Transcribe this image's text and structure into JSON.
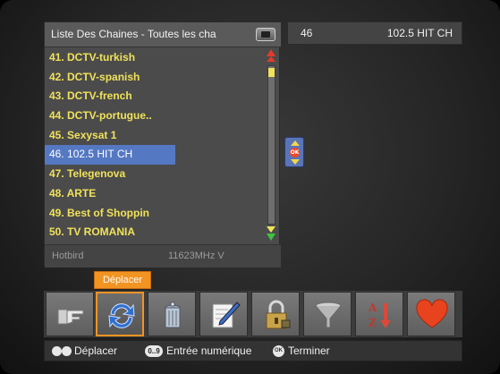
{
  "channel_list": {
    "title": "Liste Des Chaines - Toutes les cha",
    "rows": [
      "41. DCTV-turkish",
      "42. DCTV-spanish",
      "43. DCTV-french",
      "44. DCTV-portugue..",
      "45. Sexysat 1",
      "46. 102.5 HIT CH",
      "47. Telegenova",
      "48. ARTE",
      "49. Best of Shoppin",
      "50. TV ROMANIA"
    ],
    "selected_index": 5,
    "footer": {
      "satellite": "Hotbird",
      "frequency": "11623MHz V"
    }
  },
  "info": {
    "number": "46",
    "name": "102.5 HIT CH"
  },
  "ok_pad": {
    "label": "OK"
  },
  "tooltip": {
    "label": "Déplacer"
  },
  "toolbar": {
    "items": [
      {
        "icon": "hand-pointer-icon"
      },
      {
        "icon": "move-arrows-icon",
        "active": true
      },
      {
        "icon": "trash-icon"
      },
      {
        "icon": "edit-pen-icon"
      },
      {
        "icon": "lock-icon"
      },
      {
        "icon": "filter-funnel-icon"
      },
      {
        "icon": "sort-az-icon"
      },
      {
        "icon": "favorite-heart-icon"
      }
    ]
  },
  "help": {
    "move_label": "Déplacer",
    "num_key": "0..9",
    "num_label": "Entrée numérique",
    "ok_key": "OK",
    "ok_label": "Terminer"
  },
  "colors": {
    "row_text": "#f0e25a",
    "selection": "#5478c2",
    "accent_orange": "#f29422"
  }
}
